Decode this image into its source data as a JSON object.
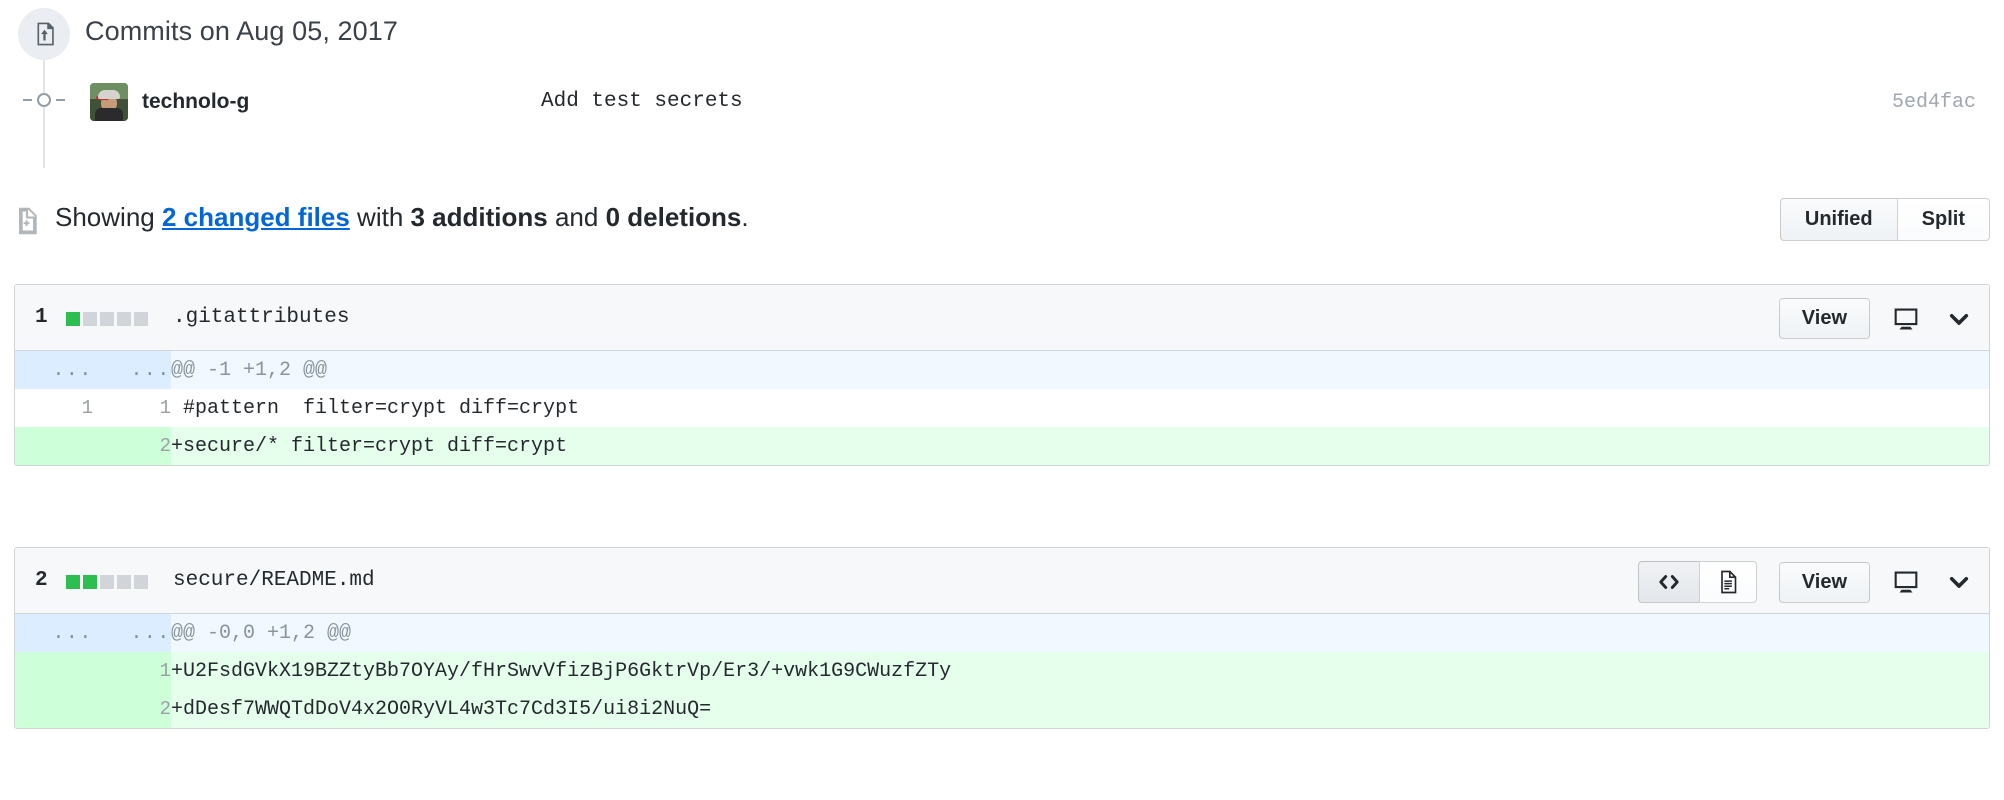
{
  "timeline": {
    "badge_icon": "git-commit-push-icon",
    "header_title": "Commits on Aug 05, 2017",
    "commit": {
      "author": "technolo-g",
      "message": "Add test secrets",
      "sha": "5ed4fac",
      "avatar_alt": "technolo-g avatar"
    }
  },
  "summary": {
    "icon": "diff-file-icon",
    "prefix": "Showing ",
    "changed_files_link": "2 changed files",
    "middle": " with ",
    "additions": "3 additions",
    "conjunction": " and ",
    "deletions": "0 deletions",
    "suffix": "."
  },
  "diff_toggle": {
    "unified_label": "Unified",
    "split_label": "Split",
    "selected": "Unified"
  },
  "files": [
    {
      "index": "1",
      "name": ".gitattributes",
      "stat_blocks": [
        "green",
        "gray",
        "gray",
        "gray",
        "gray"
      ],
      "has_render_toggle": false,
      "view_label": "View",
      "monitor_icon": "desktop-icon",
      "collapse_icon": "chevron-down-icon",
      "hunks": [
        {
          "old_ln": "...",
          "new_ln": "...",
          "header": "@@ -1 +1,2 @@",
          "lines": [
            {
              "type": "ctx",
              "old_ln": "1",
              "new_ln": "1",
              "text": " #pattern  filter=crypt diff=crypt"
            },
            {
              "type": "add",
              "old_ln": "",
              "new_ln": "2",
              "text": "+secure/* filter=crypt diff=crypt"
            }
          ]
        }
      ]
    },
    {
      "index": "2",
      "name": "secure/README.md",
      "stat_blocks": [
        "green",
        "green",
        "gray",
        "gray",
        "gray"
      ],
      "has_render_toggle": true,
      "code_view_icon": "code-brackets-icon",
      "rendered_view_icon": "document-icon",
      "view_label": "View",
      "monitor_icon": "desktop-icon",
      "collapse_icon": "chevron-down-icon",
      "hunks": [
        {
          "old_ln": "...",
          "new_ln": "...",
          "header": "@@ -0,0 +1,2 @@",
          "lines": [
            {
              "type": "add",
              "old_ln": "",
              "new_ln": "1",
              "text": "+U2FsdGVkX19BZZtyBb7OYAy/fHrSwvVfizBjP6GktrVp/Er3/+vwk1G9CWuzfZTy"
            },
            {
              "type": "add",
              "old_ln": "",
              "new_ln": "2",
              "text": "+dDesf7WWQTdDoV4x2O0RyVL4w3Tc7Cd3I5/ui8i2NuQ="
            }
          ]
        }
      ]
    }
  ],
  "colors": {
    "addition_bg": "#e6ffed",
    "addition_gutter": "#cdffd8",
    "hunk_bg": "#f1f8ff",
    "hunk_gutter": "#dbedff",
    "stat_green": "#2cbe4e",
    "stat_gray": "#d1d5da",
    "link_blue": "#0366d6",
    "border": "#d1d5da"
  }
}
